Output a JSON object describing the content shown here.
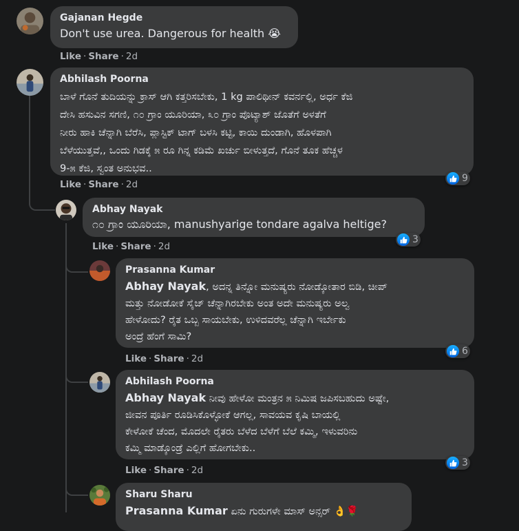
{
  "comments": [
    {
      "author": "Gajanan Hegde",
      "text": "Don't use urea. Dangerous for health 😭",
      "like_label": "Like",
      "share_label": "Share",
      "time": "2d"
    },
    {
      "author": "Abhilash Poorna",
      "text": "ಬಾಳೆ ಗೊನೆ ತುದಿಯನ್ನು ಕ್ರಾಸ್ ಆಗಿ ಕತ್ತರಿಸಬೇಕು, 1 kg ಪಾಲಿಥೀನ್ ಕವರ್ನಲ್ಲಿ, ಅರ್ಧ ಕೆಜಿ\nದೇಸಿ ಹಸುವಿನ ಸಗಣಿ, ೧೦ ಗ್ರಾಂ ಯೂರಿಯಾ, ೩೦ ಗ್ರಾಂ ಪೊಟ್ಯಾಶ್ ಜೊತೆಗೆ ಅಳತೆಗೆ\nನೀರು ಹಾಕಿ ಚೆನ್ನಾಗಿ ಬೆರೆಸಿ, ಪ್ಲಾಸ್ಟಿಕ್ ಟಾಗ್ ಬಳಸಿ ಕಟ್ಟಿ, ಕಾಯಿ ದುಂಡಾಗಿ, ಹೊಳಪಾಗಿ\nಬೆಳೆಯುತ್ತವೆ,, ಒಂದು ಗಿಡಕ್ಕೆ ೫ ರೂ ಗಿನ್ನ ಕಡಿಮೆ ಖರ್ಚು ಬೀಳುತ್ತದೆ, ಗೊನೆ ತೂಕ ಹೆಚ್ಚಳ\n9-೫ ಕೆಜಿ, ಸ್ವಂತ ಅನುಭವ..",
      "like_label": "Like",
      "share_label": "Share",
      "time": "2d",
      "reactions": "9"
    },
    {
      "author": "Abhay Nayak",
      "text": "೧೦ ಗ್ರಾಂ ಯೂರಿಯಾ, manushyarige tondare agalva heltige?",
      "like_label": "Like",
      "share_label": "Share",
      "time": "2d",
      "reactions": "3"
    },
    {
      "author": "Prasanna Kumar",
      "mention": "Abhay Nayak",
      "text": ", ಅದನ್ನ ತಿನ್ನೋ ಮನುಷ್ಯರು ನೋಡ್ಕೋತಾರ ಬಿಡಿ, ಚೀಪ್\nಮತ್ತು ನೋಡೋಕೆ ಸೈಜ್ ಚೆನ್ನಾಗಿರಬೇಕು ಅಂತ ಅದೇ ಮನುಷ್ಯರು ಅಲ್ವ\nಹೇಳೋದು? ರೈತ ಒಬ್ಬ ಸಾಯಬೇಕು, ಉಳಿದವರೆಲ್ಲ ಚೆನ್ನಾಗಿ ಇರ್ಬೇಕು\nಅಂದ್ರೆ ಹೆಂಗೆ ಸಾಮಿ?",
      "like_label": "Like",
      "share_label": "Share",
      "time": "2d",
      "reactions": "6"
    },
    {
      "author": "Abhilash Poorna",
      "mention": "Abhay Nayak",
      "text": " ನೀವು ಹೇಳೋ ಮಂತ್ರನ ೫ ನಿಮಿಷ ಜಪಿಸಬಹುದು ಅಷ್ಟೇ,\nಜೀವನ ಪೂರ್ತಿ ರೂಡಿಸಿಕೊಳ್ಳೋಕೆ ಆಗಲ್ಲ, ಸಾವಯವ ಕೃಷಿ ಬಾಯಲ್ಲಿ\nಕೇಳೋಕೆ ಚೆಂದ, ಮೊದಲೇ ರೈತರು ಬೆಳೆದ ಬೆಳೆಗೆ ಬೆಲೆ ಕಮ್ಮಿ, ಇಳುವರಿನು\nಕಮ್ಮಿ ಮಾಡ್ಕೊಂಡ್ರೆ ಎಲ್ಲಿಗೆ ಹೋಗಬೇಕು..",
      "like_label": "Like",
      "share_label": "Share",
      "time": "2d",
      "reactions": "3"
    },
    {
      "author": "Sharu Sharu",
      "mention": "Prasanna Kumar",
      "text": " ಏನು ಗುರುಗಳೇ ಮಾಸ್ ಅನ್ಸರ್ 👌🌹"
    }
  ],
  "colors": {
    "background": "#18191a",
    "bubble": "#3a3b3c",
    "text": "#e4e6eb",
    "secondary_text": "#b0b3b8",
    "like_blue": "#1877f2"
  },
  "icons": {
    "reaction": "like-thumb-icon"
  }
}
